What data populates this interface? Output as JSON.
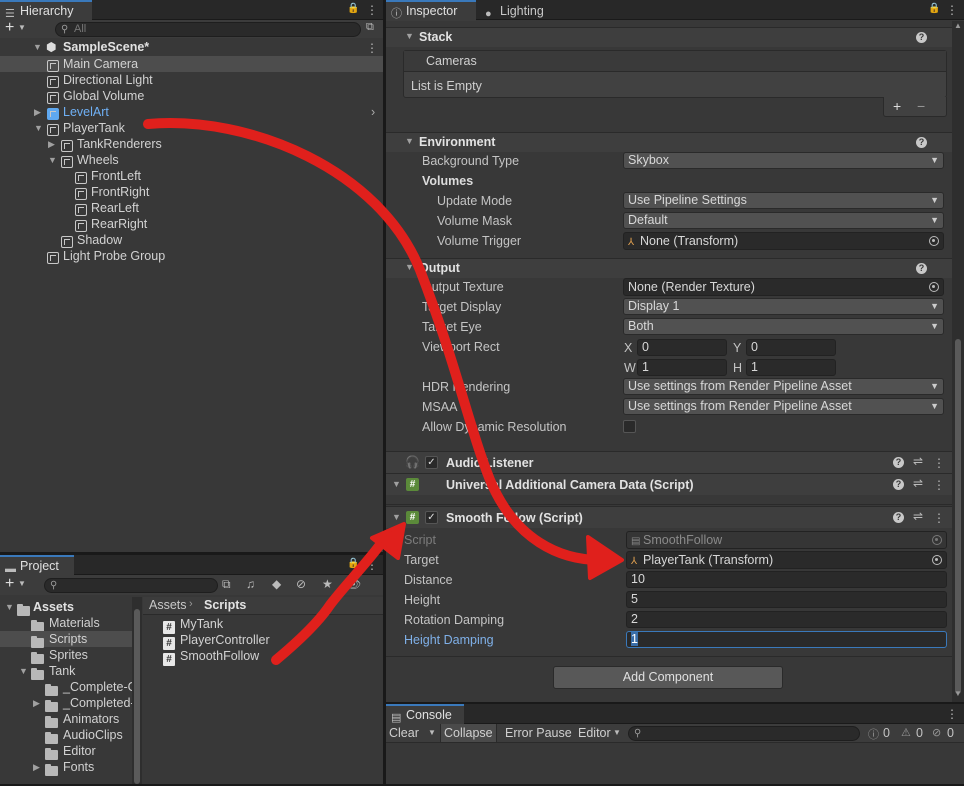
{
  "hierarchy": {
    "tab": "Hierarchy",
    "search_placeholder": "All",
    "scene": "SampleScene*",
    "items": [
      {
        "label": "Main Camera",
        "depth": 1,
        "selected": true
      },
      {
        "label": "Directional Light",
        "depth": 1
      },
      {
        "label": "Global Volume",
        "depth": 1
      },
      {
        "label": "LevelArt",
        "depth": 1,
        "prefab": true,
        "expander": "collapsed"
      },
      {
        "label": "PlayerTank",
        "depth": 1,
        "expander": "expanded"
      },
      {
        "label": "TankRenderers",
        "depth": 2,
        "expander": "collapsed"
      },
      {
        "label": "Wheels",
        "depth": 2,
        "expander": "expanded"
      },
      {
        "label": "FrontLeft",
        "depth": 3
      },
      {
        "label": "FrontRight",
        "depth": 3
      },
      {
        "label": "RearLeft",
        "depth": 3
      },
      {
        "label": "RearRight",
        "depth": 3
      },
      {
        "label": "Shadow",
        "depth": 2
      },
      {
        "label": "Light Probe Group",
        "depth": 1
      }
    ]
  },
  "inspector": {
    "tabs": [
      "Inspector",
      "Lighting"
    ],
    "stack": {
      "title": "Stack",
      "cameras_label": "Cameras",
      "empty": "List is Empty",
      "add": "+",
      "remove": "−"
    },
    "environment": {
      "title": "Environment",
      "background_type_label": "Background Type",
      "background_type": "Skybox",
      "volumes_label": "Volumes",
      "update_mode_label": "Update Mode",
      "update_mode": "Use Pipeline Settings",
      "volume_mask_label": "Volume Mask",
      "volume_mask": "Default",
      "volume_trigger_label": "Volume Trigger",
      "volume_trigger": "None (Transform)"
    },
    "output": {
      "title": "Output",
      "output_texture_label": "Output Texture",
      "output_texture": "None (Render Texture)",
      "target_display_label": "Target Display",
      "target_display": "Display 1",
      "target_eye_label": "Target Eye",
      "target_eye": "Both",
      "viewport_label": "Viewport Rect",
      "x_label": "X",
      "x": "0",
      "y_label": "Y",
      "y": "0",
      "w_label": "W",
      "w": "1",
      "h_label": "H",
      "h": "1",
      "hdr_label": "HDR Rendering",
      "hdr": "Use settings from Render Pipeline Asset",
      "msaa_label": "MSAA",
      "msaa": "Use settings from Render Pipeline Asset",
      "dynres_label": "Allow Dynamic Resolution"
    },
    "audio_listener": "Audio Listener",
    "uacd": "Universal Additional Camera Data (Script)",
    "smooth_follow": {
      "title": "Smooth Follow (Script)",
      "script_label": "Script",
      "script": "SmoothFollow",
      "target_label": "Target",
      "target": "PlayerTank (Transform)",
      "distance_label": "Distance",
      "distance": "10",
      "height_label": "Height",
      "height": "5",
      "rotation_damping_label": "Rotation Damping",
      "rotation_damping": "2",
      "height_damping_label": "Height Damping",
      "height_damping": "1"
    },
    "add_component": "Add Component"
  },
  "project": {
    "tab": "Project",
    "breadcrumb": [
      "Assets",
      "Scripts"
    ],
    "tree": [
      {
        "label": "Assets",
        "depth": 0,
        "bold": true,
        "expander": "expanded"
      },
      {
        "label": "Materials",
        "depth": 1
      },
      {
        "label": "Scripts",
        "depth": 1,
        "selected": true
      },
      {
        "label": "Sprites",
        "depth": 1
      },
      {
        "label": "Tank",
        "depth": 1,
        "expander": "expanded"
      },
      {
        "label": "_Complete-G",
        "depth": 2
      },
      {
        "label": "_Completed-",
        "depth": 2,
        "expander": "collapsed"
      },
      {
        "label": "Animators",
        "depth": 2
      },
      {
        "label": "AudioClips",
        "depth": 2
      },
      {
        "label": "Editor",
        "depth": 2
      },
      {
        "label": "Fonts",
        "depth": 2,
        "expander": "collapsed"
      }
    ],
    "files": [
      "MyTank",
      "PlayerController",
      "SmoothFollow"
    ]
  },
  "console": {
    "tab": "Console",
    "clear": "Clear",
    "collapse": "Collapse",
    "error_pause": "Error Pause",
    "editor": "Editor",
    "count_info": "0",
    "count_warn": "0",
    "count_err": "0"
  },
  "colors": {
    "accent": "#3a79bb",
    "annotation": "#e0201c",
    "selected": "#4d4d4d"
  }
}
